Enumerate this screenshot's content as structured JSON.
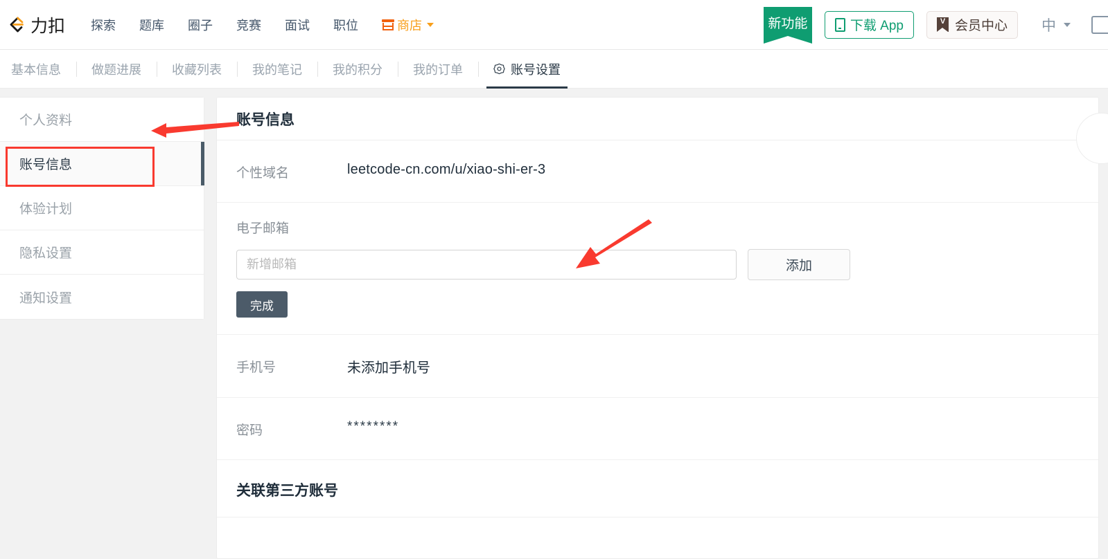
{
  "header": {
    "logo_text": "力扣",
    "logo_icon": "leetcode-logo-icon",
    "nav": [
      {
        "label": "探索",
        "icon": null
      },
      {
        "label": "题库",
        "icon": null
      },
      {
        "label": "圈子",
        "icon": null
      },
      {
        "label": "竞赛",
        "icon": null
      },
      {
        "label": "面试",
        "icon": null
      },
      {
        "label": "职位",
        "icon": null
      },
      {
        "label": "商店",
        "icon": "store-icon",
        "has_caret": true
      }
    ],
    "new_feature_badge": "新功能",
    "download_app": "下载 App",
    "download_icon": "phone-icon",
    "vip_center": "会员中心",
    "vip_icon": "ribbon-badge-icon",
    "language": "中",
    "language_caret": "chevron-down-icon",
    "accent_green": "#0f9d71",
    "accent_orange": "#f89f1b"
  },
  "subnav": {
    "tabs": [
      {
        "label": "基本信息",
        "active": false,
        "icon": null
      },
      {
        "label": "做题进展",
        "active": false,
        "icon": null
      },
      {
        "label": "收藏列表",
        "active": false,
        "icon": null
      },
      {
        "label": "我的笔记",
        "active": false,
        "icon": null
      },
      {
        "label": "我的积分",
        "active": false,
        "icon": null
      },
      {
        "label": "我的订单",
        "active": false,
        "icon": null
      },
      {
        "label": "账号设置",
        "active": true,
        "icon": "gear-icon"
      }
    ]
  },
  "sidebar": {
    "items": [
      {
        "label": "个人资料",
        "active": false
      },
      {
        "label": "账号信息",
        "active": true
      },
      {
        "label": "体验计划",
        "active": false
      },
      {
        "label": "隐私设置",
        "active": false
      },
      {
        "label": "通知设置",
        "active": false
      }
    ],
    "active_indicator_color": "#4a5b68"
  },
  "main": {
    "panel_title": "账号信息",
    "rows": {
      "domain": {
        "label": "个性域名",
        "value": "leetcode-cn.com/u/xiao-shi-er-3"
      },
      "email": {
        "label": "电子邮箱",
        "input_placeholder": "新增邮箱",
        "input_value": "",
        "add_button": "添加",
        "done_button": "完成"
      },
      "phone": {
        "label": "手机号",
        "value": "未添加手机号"
      },
      "password": {
        "label": "密码",
        "value": "********"
      }
    },
    "third_party_section": "关联第三方账号"
  },
  "annotations": {
    "highlight_color": "#f93a2f",
    "box_target": "账号信息",
    "arrow_1_target": "sidebar-item-account-info",
    "arrow_2_target": "email-input"
  }
}
